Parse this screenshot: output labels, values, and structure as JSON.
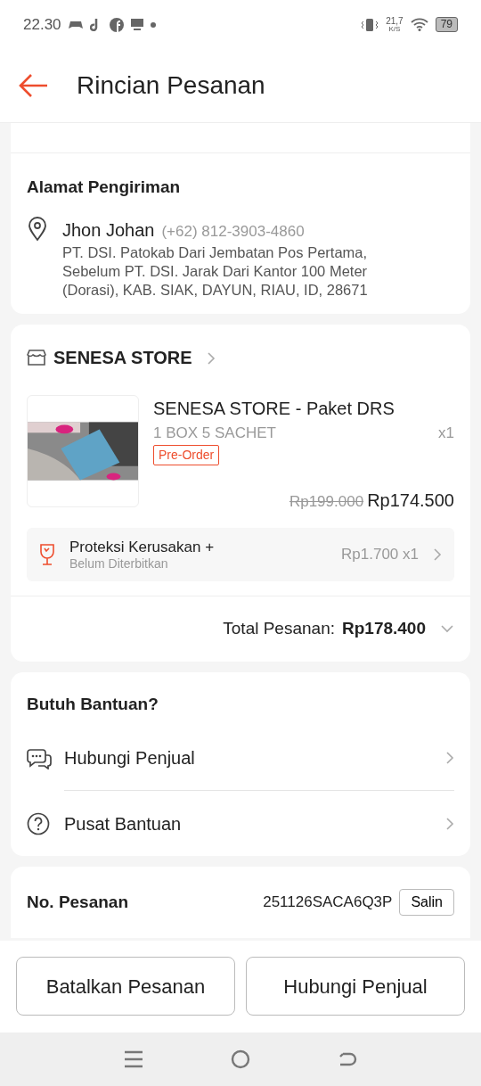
{
  "status_bar": {
    "time": "22.30",
    "speed": "21,7",
    "speed_unit": "K/S",
    "battery": "79"
  },
  "header": {
    "title": "Rincian Pesanan"
  },
  "address": {
    "heading": "Alamat Pengiriman",
    "name": "Jhon Johan",
    "phone": "(+62) 812-3903-4860",
    "lines": [
      "PT. DSI. Patokab Dari Jembatan Pos Pertama,",
      "Sebelum PT. DSI. Jarak Dari Kantor 100 Meter",
      "(Dorasi), KAB. SIAK, DAYUN, RIAU, ID, 28671"
    ]
  },
  "store": {
    "name": "SENESA STORE",
    "product": {
      "kind": "picture",
      "title": "SENESA STORE - Paket DRS",
      "variant": "1 BOX 5 SACHET",
      "quantity": "x1",
      "tag": "Pre-Order",
      "old_price": "Rp199.000",
      "price": "Rp174.500"
    },
    "protection": {
      "title": "Proteksi Kerusakan +",
      "subtitle": "Belum Diterbitkan",
      "price": "Rp1.700 x1"
    },
    "total_label": "Total Pesanan:",
    "total": "Rp178.400"
  },
  "help": {
    "heading": "Butuh Bantuan?",
    "items": [
      {
        "kind": "chat",
        "label": "Hubungi Penjual"
      },
      {
        "kind": "question",
        "label": "Pusat Bantuan"
      }
    ]
  },
  "order": {
    "label": "No. Pesanan",
    "number": "251126SACA6Q3P",
    "copy": "Salin"
  },
  "buttons": [
    "Batalkan Pesanan",
    "Hubungi Penjual"
  ]
}
